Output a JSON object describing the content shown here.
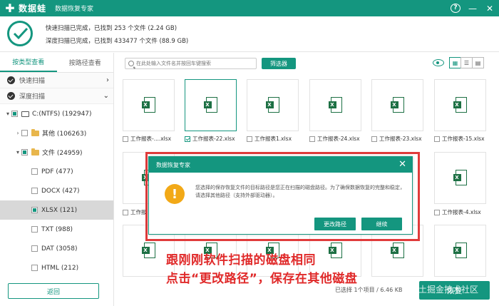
{
  "app": {
    "name": "数据蛙",
    "subtitle": "数据恢复专家",
    "logo_glyph": "✚",
    "accent": "#14967f"
  },
  "window": {
    "help": "?",
    "minimize": "—",
    "close": "✕"
  },
  "status": {
    "quick": "快速扫描已完成，已找到 253 个文件 (2.24 GB)",
    "deep": "深度扫描已完成，已找到 433477 个文件 (88.9 GB)"
  },
  "sidebar": {
    "tabs": [
      "按类型查看",
      "按路径查看"
    ],
    "scans": [
      "快速扫描",
      "深度扫描"
    ],
    "tree": [
      {
        "label": "C:(NTFS) (192947)",
        "caret": "▾",
        "icon": "drive"
      },
      {
        "label": "其他 (106263)",
        "caret": "›",
        "icon": "folder"
      },
      {
        "label": "文件 (24959)",
        "caret": "▾",
        "icon": "folder"
      },
      {
        "label": "PDF (477)",
        "caret": "",
        "icon": "none"
      },
      {
        "label": "DOCX (427)",
        "caret": "",
        "icon": "none"
      },
      {
        "label": "XLSX (121)",
        "caret": "",
        "icon": "none",
        "selected": true
      },
      {
        "label": "TXT (988)",
        "caret": "",
        "icon": "none"
      },
      {
        "label": "DAT (3058)",
        "caret": "",
        "icon": "none"
      },
      {
        "label": "HTML (212)",
        "caret": "",
        "icon": "none"
      }
    ],
    "back_label": "返回"
  },
  "toolbar": {
    "search_placeholder": "在此处输入文件名并按回车键搜索",
    "filter_label": "筛选器",
    "view_icons": [
      "grid",
      "list",
      "detail"
    ]
  },
  "files": {
    "row1": [
      "工作报表-....xlsx",
      "工作报表-22.xlsx",
      "工作报表1.xlsx",
      "工作报表-24.xlsx",
      "工作报表-23.xlsx",
      "工作报表-15.xlsx"
    ],
    "row2_left": "工作报",
    "row2_right": "工作报表-4.xlsx",
    "badge": "X"
  },
  "bottom": {
    "selected_info": "已选择 1个项目 / 6.46 KB",
    "recover_label": "恢复"
  },
  "dialog": {
    "title": "数据恢复专家",
    "close": "✕",
    "warn_glyph": "!",
    "message": "您选择的保存恢复文件的目标路径是您正在扫描的磁盘路径。为了确保数据恢复的完整和稳定，请选择其他路径（支持外部驱动器）。",
    "change_path_label": "更改路径",
    "continue_label": "继续"
  },
  "annotation": {
    "line1": "跟刚刚软件扫描的磁盘相同",
    "line2": "点击“更改路径”，保存在其他磁盘"
  },
  "watermark": "@稀土掘金技术社区"
}
